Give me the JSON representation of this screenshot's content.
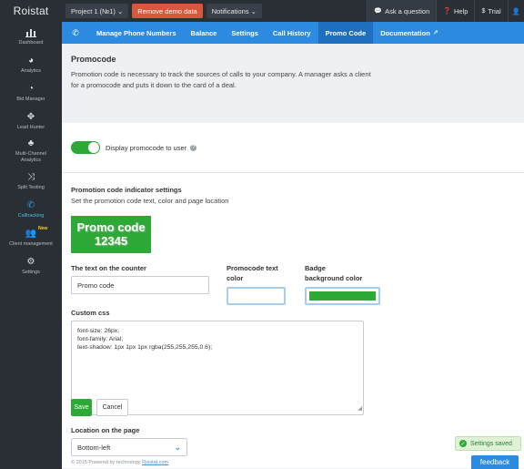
{
  "app": {
    "logo": "Roistat"
  },
  "topbar": {
    "project": "Project 1 (№1) ⌄",
    "remove_demo": "Remove demo data",
    "notifications": "Notifications ⌄",
    "ask": "Ask a question",
    "help": "Help",
    "trial": "Trial"
  },
  "sidebar": {
    "items": [
      {
        "label": "Dashboard",
        "icon": "dashboard-icon"
      },
      {
        "label": "Analytics",
        "icon": "pie-chart-icon"
      },
      {
        "label": "Bid Manager",
        "icon": "gauge-icon"
      },
      {
        "label": "Lead Hunter",
        "icon": "crosshair-icon"
      },
      {
        "label": "Multi-Channel Analytics",
        "icon": "hierarchy-icon"
      },
      {
        "label": "Split Testing",
        "icon": "shuffle-icon"
      },
      {
        "label": "Calltracking",
        "icon": "phone-icon"
      },
      {
        "label": "Client management",
        "icon": "users-icon",
        "badge": "New"
      },
      {
        "label": "Settings",
        "icon": "gear-icon"
      }
    ]
  },
  "nav": {
    "tabs": [
      {
        "label": "Manage Phone Numbers"
      },
      {
        "label": "Balance"
      },
      {
        "label": "Settings"
      },
      {
        "label": "Call History"
      },
      {
        "label": "Promo Code"
      },
      {
        "label": "Documentation"
      }
    ]
  },
  "promocode": {
    "title": "Promocode",
    "description": "Promotion code is necessary to track the sources of calls to your company. A manager asks a client for a promocode and puts it down to the card of a deal.",
    "toggle_label": "Display promocode to user"
  },
  "indicator": {
    "title": "Promotion code indicator settings",
    "subtitle": "Set the promotion code text, color and page location",
    "preview_line1": "Promo code",
    "preview_line2": "12345",
    "counter_label": "The text on the counter",
    "counter_value": "Promo code",
    "text_color_label_1": "Promocode text",
    "text_color_label_2": "color",
    "badge_label_1": "Badge",
    "badge_label_2": "background color",
    "text_color": "#ffffff",
    "badge_color": "#2ea836"
  },
  "css": {
    "label": "Custom css",
    "line1": "font-size: 26px;",
    "line2": "font-family: Arial;",
    "line3": "text-shadow: 1px 1px 1px rgba(255,255,255,0.6);"
  },
  "location": {
    "label": "Location on the page",
    "value": "Bottom-left"
  },
  "actions": {
    "save": "Save",
    "cancel": "Cancel"
  },
  "footer": {
    "prefix": "© 2015 Powered by technology ",
    "link": "Roistat.com"
  },
  "toast": {
    "text": "Settings saved"
  },
  "feedback": {
    "label": "feedback"
  }
}
